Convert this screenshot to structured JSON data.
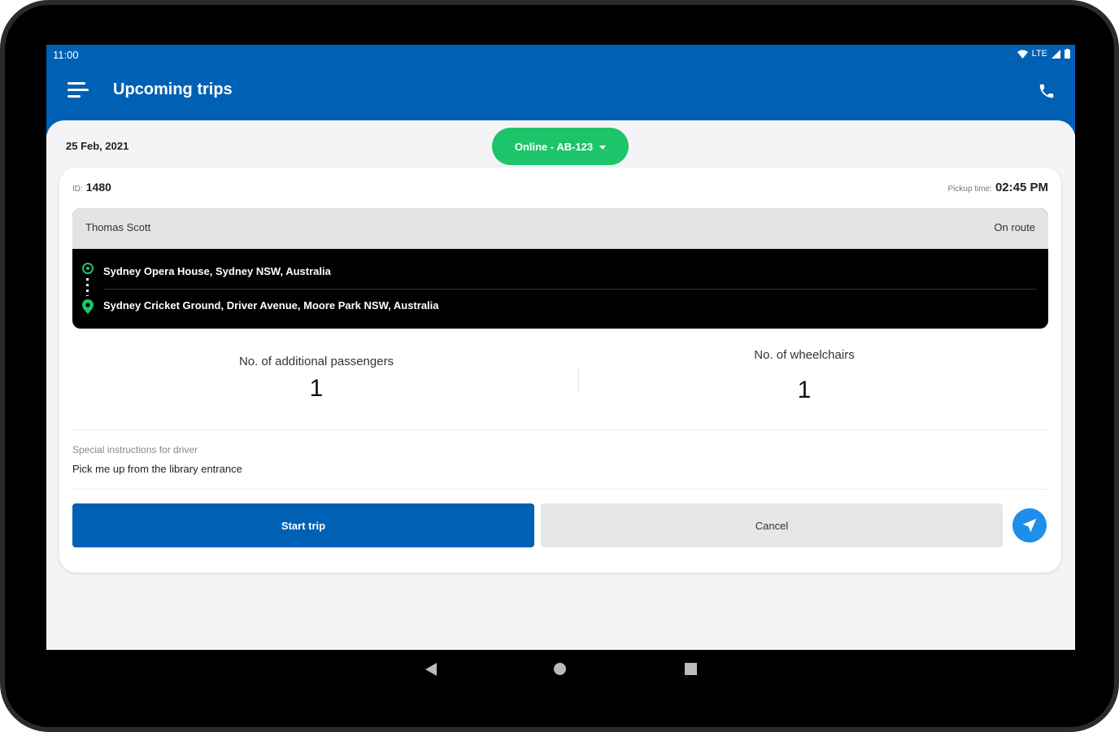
{
  "status_bar": {
    "time": "11:00",
    "network": "LTE"
  },
  "app_bar": {
    "title": "Upcoming trips",
    "menu_icon": "menu-icon",
    "phone_icon": "phone-icon"
  },
  "filter": {
    "date": "25 Feb, 2021",
    "status": "Online - AB-123"
  },
  "trip": {
    "id_label": "ID:",
    "id": "1480",
    "pickup_label": "Pickup time:",
    "pickup_time": "02:45 PM",
    "rider_name": "Thomas Scott",
    "rider_status": "On route",
    "pickup_address": "Sydney Opera House, Sydney NSW, Australia",
    "dropoff_address": "Sydney Cricket Ground, Driver Avenue, Moore Park NSW, Australia",
    "passengers_label": "No. of additional passengers",
    "passengers": "1",
    "wheelchairs_label": "No. of wheelchairs",
    "wheelchairs": "1",
    "instructions_label": "Special instructions for driver",
    "instructions": "Pick me up from the library entrance"
  },
  "actions": {
    "start": "Start trip",
    "cancel": "Cancel"
  },
  "colors": {
    "primary": "#0060b4",
    "online": "#1ec46a",
    "navigate": "#1d8fea"
  }
}
